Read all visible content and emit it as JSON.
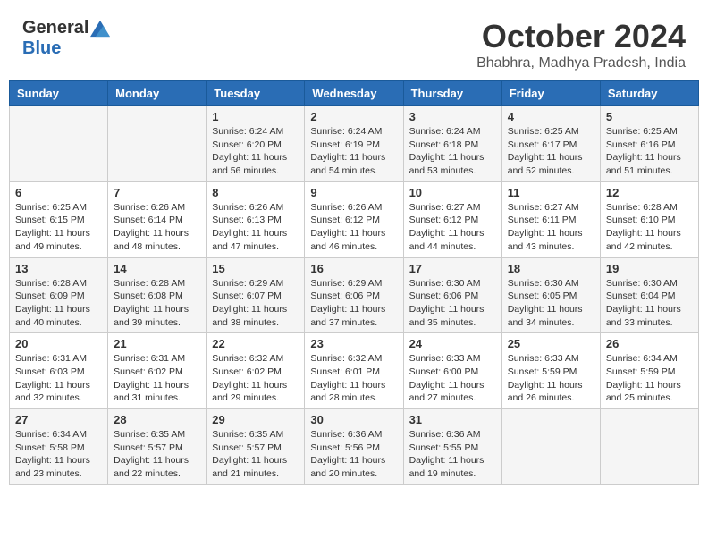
{
  "header": {
    "logo_general": "General",
    "logo_blue": "Blue",
    "month": "October 2024",
    "location": "Bhabhra, Madhya Pradesh, India"
  },
  "weekdays": [
    "Sunday",
    "Monday",
    "Tuesday",
    "Wednesday",
    "Thursday",
    "Friday",
    "Saturday"
  ],
  "weeks": [
    [
      {
        "day": "",
        "info": ""
      },
      {
        "day": "",
        "info": ""
      },
      {
        "day": "1",
        "info": "Sunrise: 6:24 AM\nSunset: 6:20 PM\nDaylight: 11 hours and 56 minutes."
      },
      {
        "day": "2",
        "info": "Sunrise: 6:24 AM\nSunset: 6:19 PM\nDaylight: 11 hours and 54 minutes."
      },
      {
        "day": "3",
        "info": "Sunrise: 6:24 AM\nSunset: 6:18 PM\nDaylight: 11 hours and 53 minutes."
      },
      {
        "day": "4",
        "info": "Sunrise: 6:25 AM\nSunset: 6:17 PM\nDaylight: 11 hours and 52 minutes."
      },
      {
        "day": "5",
        "info": "Sunrise: 6:25 AM\nSunset: 6:16 PM\nDaylight: 11 hours and 51 minutes."
      }
    ],
    [
      {
        "day": "6",
        "info": "Sunrise: 6:25 AM\nSunset: 6:15 PM\nDaylight: 11 hours and 49 minutes."
      },
      {
        "day": "7",
        "info": "Sunrise: 6:26 AM\nSunset: 6:14 PM\nDaylight: 11 hours and 48 minutes."
      },
      {
        "day": "8",
        "info": "Sunrise: 6:26 AM\nSunset: 6:13 PM\nDaylight: 11 hours and 47 minutes."
      },
      {
        "day": "9",
        "info": "Sunrise: 6:26 AM\nSunset: 6:12 PM\nDaylight: 11 hours and 46 minutes."
      },
      {
        "day": "10",
        "info": "Sunrise: 6:27 AM\nSunset: 6:12 PM\nDaylight: 11 hours and 44 minutes."
      },
      {
        "day": "11",
        "info": "Sunrise: 6:27 AM\nSunset: 6:11 PM\nDaylight: 11 hours and 43 minutes."
      },
      {
        "day": "12",
        "info": "Sunrise: 6:28 AM\nSunset: 6:10 PM\nDaylight: 11 hours and 42 minutes."
      }
    ],
    [
      {
        "day": "13",
        "info": "Sunrise: 6:28 AM\nSunset: 6:09 PM\nDaylight: 11 hours and 40 minutes."
      },
      {
        "day": "14",
        "info": "Sunrise: 6:28 AM\nSunset: 6:08 PM\nDaylight: 11 hours and 39 minutes."
      },
      {
        "day": "15",
        "info": "Sunrise: 6:29 AM\nSunset: 6:07 PM\nDaylight: 11 hours and 38 minutes."
      },
      {
        "day": "16",
        "info": "Sunrise: 6:29 AM\nSunset: 6:06 PM\nDaylight: 11 hours and 37 minutes."
      },
      {
        "day": "17",
        "info": "Sunrise: 6:30 AM\nSunset: 6:06 PM\nDaylight: 11 hours and 35 minutes."
      },
      {
        "day": "18",
        "info": "Sunrise: 6:30 AM\nSunset: 6:05 PM\nDaylight: 11 hours and 34 minutes."
      },
      {
        "day": "19",
        "info": "Sunrise: 6:30 AM\nSunset: 6:04 PM\nDaylight: 11 hours and 33 minutes."
      }
    ],
    [
      {
        "day": "20",
        "info": "Sunrise: 6:31 AM\nSunset: 6:03 PM\nDaylight: 11 hours and 32 minutes."
      },
      {
        "day": "21",
        "info": "Sunrise: 6:31 AM\nSunset: 6:02 PM\nDaylight: 11 hours and 31 minutes."
      },
      {
        "day": "22",
        "info": "Sunrise: 6:32 AM\nSunset: 6:02 PM\nDaylight: 11 hours and 29 minutes."
      },
      {
        "day": "23",
        "info": "Sunrise: 6:32 AM\nSunset: 6:01 PM\nDaylight: 11 hours and 28 minutes."
      },
      {
        "day": "24",
        "info": "Sunrise: 6:33 AM\nSunset: 6:00 PM\nDaylight: 11 hours and 27 minutes."
      },
      {
        "day": "25",
        "info": "Sunrise: 6:33 AM\nSunset: 5:59 PM\nDaylight: 11 hours and 26 minutes."
      },
      {
        "day": "26",
        "info": "Sunrise: 6:34 AM\nSunset: 5:59 PM\nDaylight: 11 hours and 25 minutes."
      }
    ],
    [
      {
        "day": "27",
        "info": "Sunrise: 6:34 AM\nSunset: 5:58 PM\nDaylight: 11 hours and 23 minutes."
      },
      {
        "day": "28",
        "info": "Sunrise: 6:35 AM\nSunset: 5:57 PM\nDaylight: 11 hours and 22 minutes."
      },
      {
        "day": "29",
        "info": "Sunrise: 6:35 AM\nSunset: 5:57 PM\nDaylight: 11 hours and 21 minutes."
      },
      {
        "day": "30",
        "info": "Sunrise: 6:36 AM\nSunset: 5:56 PM\nDaylight: 11 hours and 20 minutes."
      },
      {
        "day": "31",
        "info": "Sunrise: 6:36 AM\nSunset: 5:55 PM\nDaylight: 11 hours and 19 minutes."
      },
      {
        "day": "",
        "info": ""
      },
      {
        "day": "",
        "info": ""
      }
    ]
  ]
}
